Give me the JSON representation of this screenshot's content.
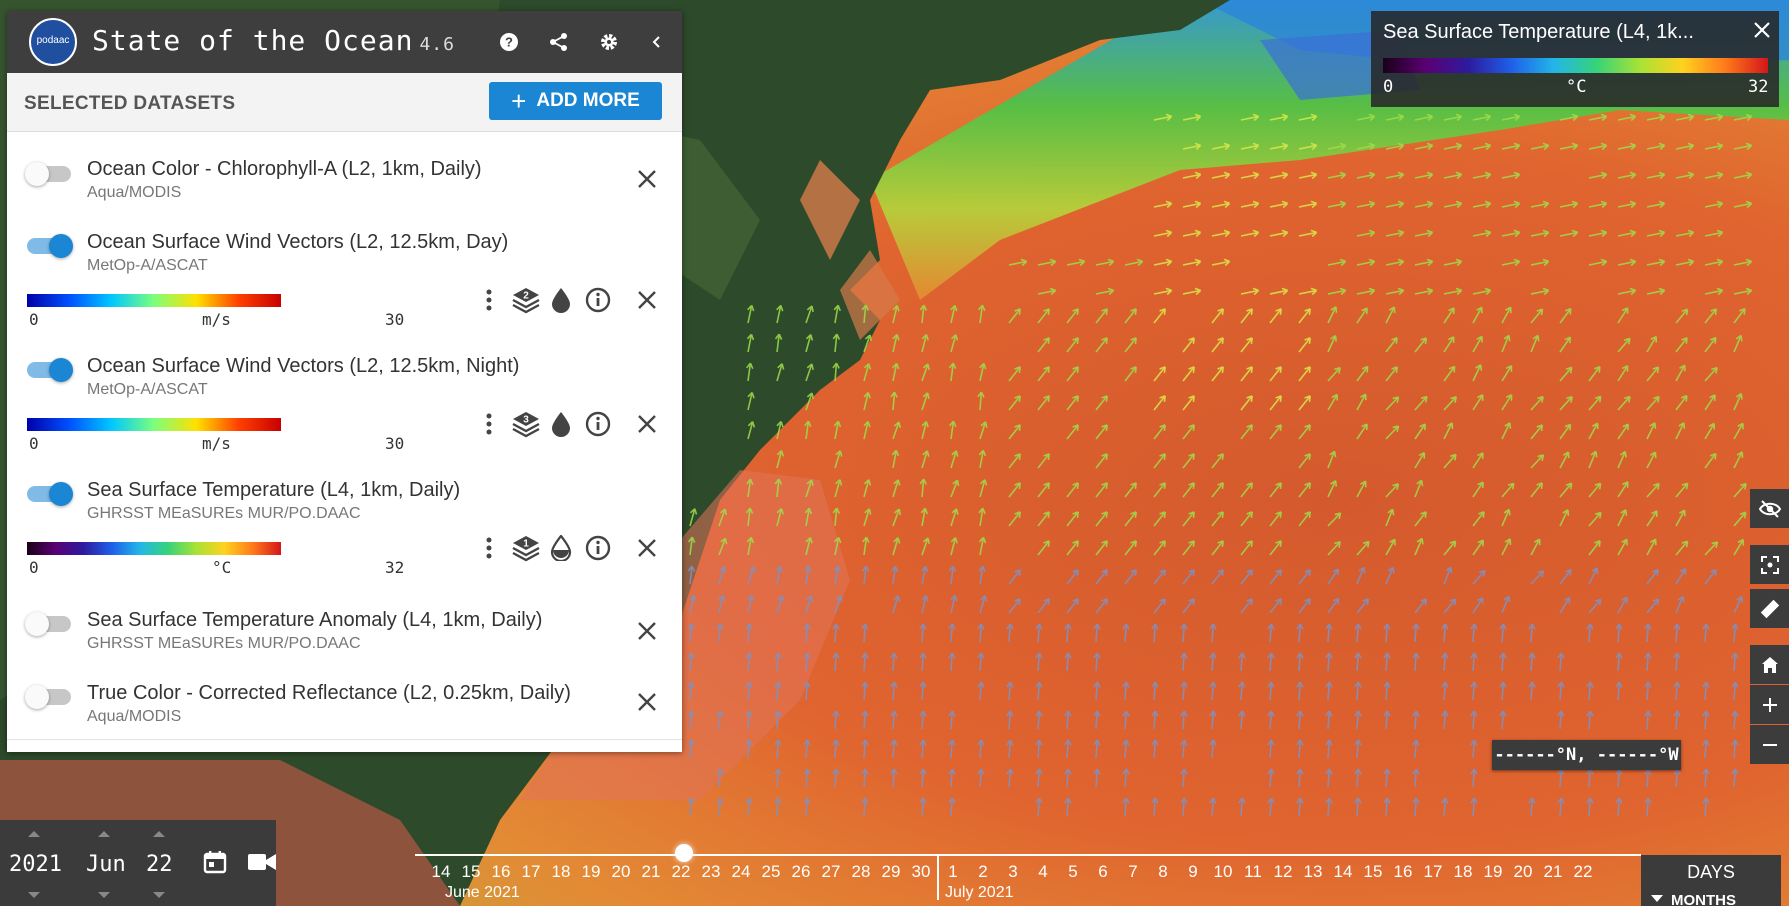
{
  "app": {
    "title": "State of the Ocean",
    "version": "4.6",
    "logo_text": "podaac",
    "header_icons": [
      "help-icon",
      "share-icon",
      "settings-icon",
      "collapse-icon"
    ]
  },
  "selected": {
    "heading": "SELECTED DATASETS",
    "add_more_label": "ADD MORE"
  },
  "datasets": [
    {
      "title": "Ocean Color - Chlorophyll-A (L2, 1km, Daily)",
      "source": "Aqua/MODIS",
      "enabled": false
    },
    {
      "title": "Ocean Surface Wind Vectors (L2, 12.5km, Day)",
      "source": "MetOp-A/ASCAT",
      "enabled": true,
      "scale_min": "0",
      "scale_unit": "m/s",
      "scale_max": "30",
      "layer_number": "2"
    },
    {
      "title": "Ocean Surface Wind Vectors (L2, 12.5km, Night)",
      "source": "MetOp-A/ASCAT",
      "enabled": true,
      "scale_min": "0",
      "scale_unit": "m/s",
      "scale_max": "30",
      "layer_number": "3"
    },
    {
      "title": "Sea Surface Temperature (L4, 1km, Daily)",
      "source": "GHRSST MEaSUREs MUR/PO.DAAC",
      "enabled": true,
      "scale_min": "0",
      "scale_unit": "°C",
      "scale_max": "32",
      "layer_number": "1"
    },
    {
      "title": "Sea Surface Temperature Anomaly (L4, 1km, Daily)",
      "source": "GHRSST MEaSUREs MUR/PO.DAAC",
      "enabled": false
    },
    {
      "title": "True Color - Corrected Reflectance (L2, 0.25km, Daily)",
      "source": "Aqua/MODIS",
      "enabled": false
    }
  ],
  "legend": {
    "title": "Sea Surface Temperature (L4, 1k...",
    "min": "0",
    "unit": "°C",
    "max": "32"
  },
  "coordinates": "------°N, ------°W",
  "date": {
    "year": "2021",
    "month": "Jun",
    "day": "22"
  },
  "timeline": {
    "june_label": "June 2021",
    "july_label": "July 2021",
    "june_days": [
      "14",
      "15",
      "16",
      "17",
      "18",
      "19",
      "20",
      "21",
      "22",
      "23",
      "24",
      "25",
      "26",
      "27",
      "28",
      "29",
      "30"
    ],
    "july_days": [
      "1",
      "2",
      "3",
      "4",
      "5",
      "6",
      "7",
      "8",
      "9",
      "10",
      "11",
      "12",
      "13",
      "14",
      "15",
      "16",
      "17",
      "18",
      "19",
      "20",
      "21",
      "22"
    ],
    "selected_day": "22",
    "zoom_level": "DAYS",
    "zoom_next": "MONTHS"
  },
  "colors": {
    "accent": "#1a86d4",
    "header_bg": "#3e3e3e",
    "ocean_warm": "#d7502a",
    "ocean_cool": "#5fc94a"
  }
}
